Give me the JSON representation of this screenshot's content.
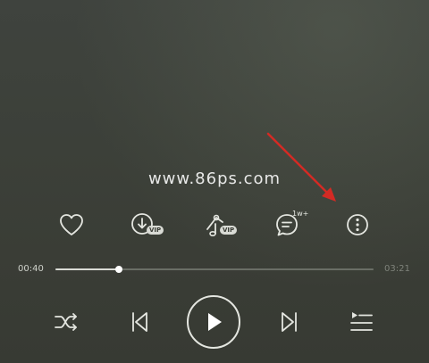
{
  "watermark": {
    "text": "www.86ps.com"
  },
  "actions": {
    "like": {
      "icon": "heart-icon"
    },
    "download": {
      "icon": "download-icon",
      "badge": "VIP"
    },
    "ringtone": {
      "icon": "music-note-icon",
      "badge": "VIP"
    },
    "comments": {
      "icon": "comment-icon",
      "count": "1w+"
    },
    "more": {
      "icon": "more-vertical-icon"
    }
  },
  "progress": {
    "elapsed": "00:40",
    "total": "03:21",
    "fraction": 0.199
  },
  "controls": {
    "shuffle": {
      "icon": "shuffle-icon"
    },
    "previous": {
      "icon": "previous-icon"
    },
    "play": {
      "icon": "play-icon"
    },
    "next": {
      "icon": "next-icon"
    },
    "playlist": {
      "icon": "playlist-icon"
    }
  },
  "colors": {
    "background": "#3c4039",
    "icon": "#e4e6e0",
    "annotation_arrow": "#d42a24",
    "track": "#6a6e66",
    "track_fill": "#d9dbd5"
  }
}
